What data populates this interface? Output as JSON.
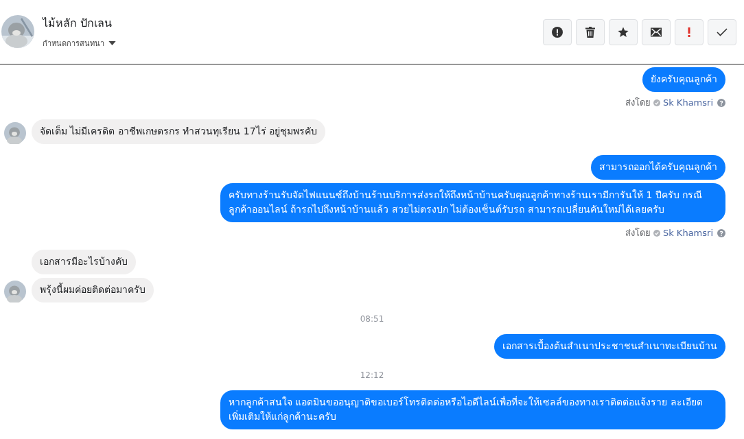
{
  "header": {
    "name": "ไม้หลัก ปักเลน",
    "subtitle": "กำหนดการสนทนา",
    "actions": [
      {
        "kind": "alert"
      },
      {
        "kind": "trash"
      },
      {
        "kind": "star"
      },
      {
        "kind": "mail"
      },
      {
        "kind": "important"
      },
      {
        "kind": "done"
      }
    ]
  },
  "messages": [
    {
      "kind": "out",
      "text": "ยังครับคุณลูกค้า"
    },
    {
      "kind": "sender",
      "label": "ส่งโดย",
      "name": "Sk Khamsri"
    },
    {
      "kind": "in",
      "text": "จัดเต็ม  ไม่มีเครดิต  อาชีพเกษตรกร ทำสวนทุเรียน  17ไร่ อยู่ชุมพรคับ",
      "avatar": true
    },
    {
      "kind": "out",
      "text": "สามารถออกได้ครับคุณลูกค้า"
    },
    {
      "kind": "out",
      "text": "ครับทางร้านรับจัดไฟแนนซ์ถึงบ้านร้านบริการส่งรถให้ถึงหน้าบ้านครับคุณลูกค้าทางร้านเรามีการันให้ 1 ปีครับ กรณีลูกค้าออนไลน์ ถ้ารถไปถึงหน้าบ้านแล้ว สวยไม่ตรงปก ไม่ต้องเซ็นต์รับรถ สามารถเปลี่ยนคันใหม่ได้เลยครับ"
    },
    {
      "kind": "sender",
      "label": "ส่งโดย",
      "name": "Sk Khamsri"
    },
    {
      "kind": "in",
      "text": "เอกสารมีอะไรบ้างคับ",
      "avatar": false
    },
    {
      "kind": "in",
      "text": "พรุ้งนี้ผมค่อยติดต่อมาครับ",
      "avatar": true
    },
    {
      "kind": "time",
      "text": "08:51"
    },
    {
      "kind": "out",
      "text": "เอกสารเบื้องต้นสำเนาประชาชนสำเนาทะเบียนบ้าน"
    },
    {
      "kind": "time",
      "text": "12:12"
    },
    {
      "kind": "out",
      "text": "หากลูกค้าสนใจ แอดมินขออนุญาติขอเบอร์โทรติดต่อหรือไอดีไลน์เพื่อที่จะให้เซลล์ของทางเราติดต่อแจ้งราย ละเอียดเพิ่มเติมให้แก่ลูกค้านะครับ"
    }
  ]
}
